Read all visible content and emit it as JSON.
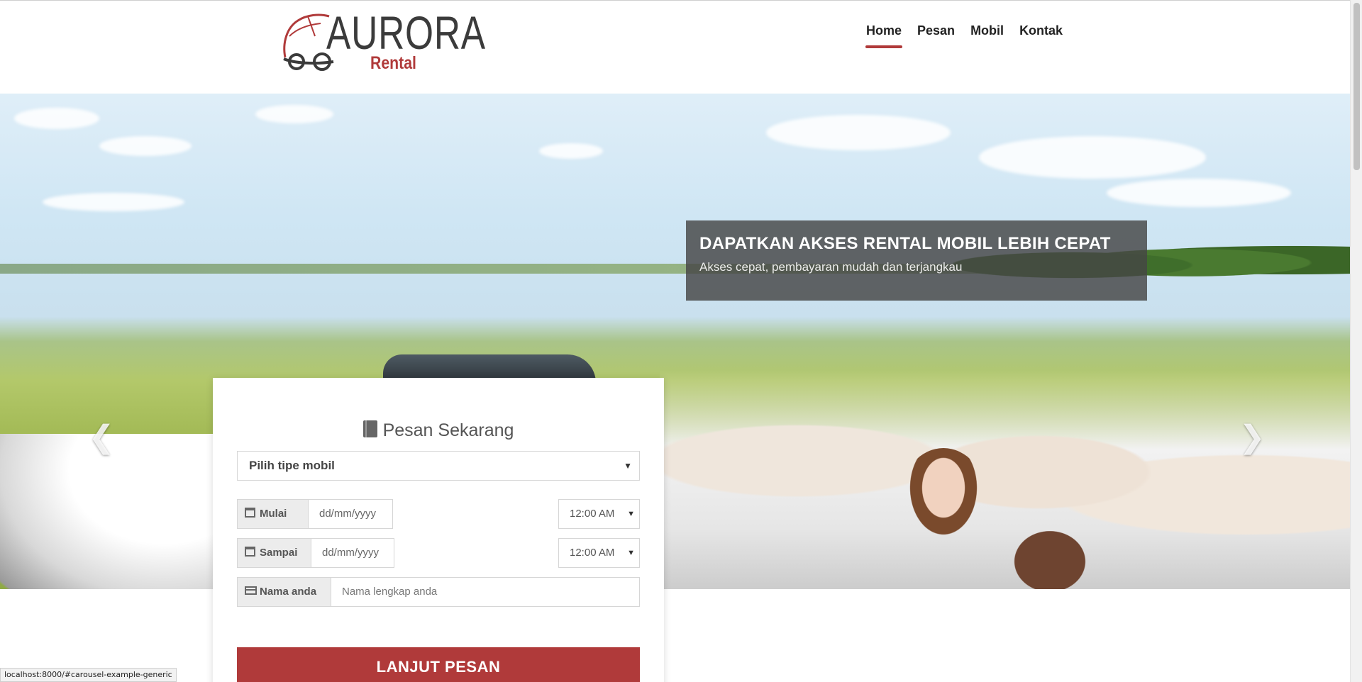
{
  "header": {
    "logo": {
      "word": "AURORA",
      "sub": "Rental"
    },
    "nav": [
      {
        "label": "Home",
        "active": true
      },
      {
        "label": "Pesan",
        "active": false
      },
      {
        "label": "Mobil",
        "active": false
      },
      {
        "label": "Kontak",
        "active": false
      }
    ]
  },
  "hero": {
    "caption_title": "DAPATKAN AKSES RENTAL MOBIL LEBIH CEPAT",
    "caption_text": "Akses cepat, pembayaran mudah dan terjangkau",
    "prev_icon": "chevron-left-icon",
    "next_icon": "chevron-right-icon"
  },
  "booking": {
    "title": "Pesan Sekarang",
    "title_icon": "book-icon",
    "car_select": "Pilih tipe mobil",
    "start_label": "Mulai",
    "start_date_placeholder": "dd/mm/yyyy",
    "start_time": "12:00 AM",
    "end_label": "Sampai",
    "end_date_placeholder": "dd/mm/yyyy",
    "end_time": "12:00 AM",
    "name_label": "Nama anda",
    "name_placeholder": "Nama lengkap anda",
    "submit_label": "LANJUT PESAN"
  },
  "status_bar": "localhost:8000/#carousel-example-generic",
  "colors": {
    "accent": "#b03a3a",
    "text": "#222222",
    "caption_bg": "#464646"
  }
}
